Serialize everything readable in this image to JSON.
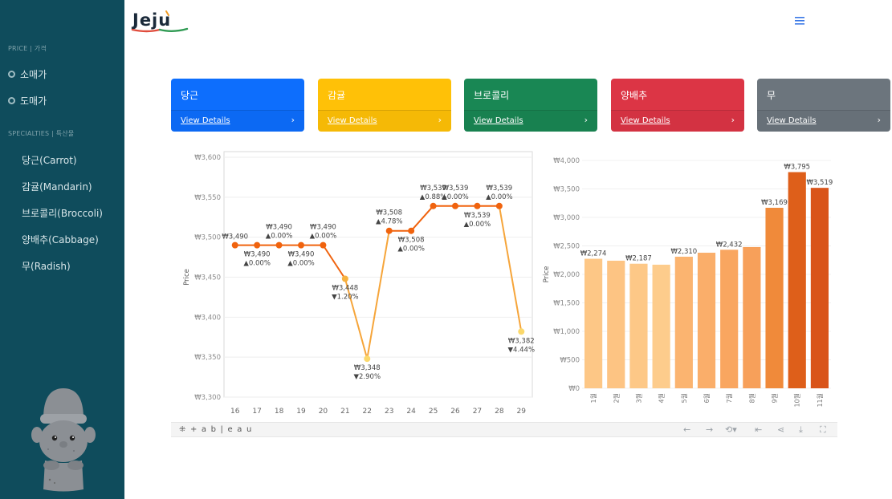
{
  "app": {
    "logo_text": "Jeju"
  },
  "sidebar": {
    "price_header": "PRICE | 가격",
    "price_items": [
      {
        "label": "소매가",
        "icon": "circle-icon"
      },
      {
        "label": "도매가",
        "icon": "circle-icon"
      }
    ],
    "specialties_header": "SPECIALTIES | 특산물",
    "specialties": [
      {
        "label": "당근(Carrot)"
      },
      {
        "label": "감귤(Mandarin)"
      },
      {
        "label": "브로콜리(Broccoli)"
      },
      {
        "label": "양배추(Cabbage)"
      },
      {
        "label": "무(Radish)"
      }
    ]
  },
  "header": {
    "menu_icon": "hamburger-icon"
  },
  "cards": [
    {
      "title": "당근",
      "link": "View Details",
      "color": "#0d6efd"
    },
    {
      "title": "감귤",
      "link": "View Details",
      "color": "#ffc107"
    },
    {
      "title": "브로콜리",
      "link": "View Details",
      "color": "#198754"
    },
    {
      "title": "양배추",
      "link": "View Details",
      "color": "#dc3545"
    },
    {
      "title": "무",
      "link": "View Details",
      "color": "#6c757d"
    }
  ],
  "tableau": {
    "brand": "+ a b | e a u"
  },
  "chart_data": [
    {
      "type": "line",
      "ylabel": "Price",
      "ylim": [
        3300,
        3600
      ],
      "yticks": [
        "₩3,600",
        "₩3,550",
        "₩3,500",
        "₩3,450",
        "₩3,400",
        "₩3,350",
        "₩3,300"
      ],
      "x": [
        "16",
        "17",
        "18",
        "19",
        "20",
        "21",
        "22",
        "23",
        "24",
        "25",
        "26",
        "27",
        "28",
        "29"
      ],
      "values": [
        3490,
        3490,
        3490,
        3490,
        3490,
        3448,
        3348,
        3508,
        3508,
        3539,
        3539,
        3539,
        3539,
        3382
      ],
      "labels": [
        {
          "price": "₩3,490",
          "change": ""
        },
        {
          "price": "₩3,490",
          "change": "▲0.00%"
        },
        {
          "price": "₩3,490",
          "change": "▲0.00%"
        },
        {
          "price": "₩3,490",
          "change": "▲0.00%"
        },
        {
          "price": "₩3,490",
          "change": "▲0.00%"
        },
        {
          "price": "₩3,448",
          "change": "▼1.20%"
        },
        {
          "price": "₩3,348",
          "change": "▼2.90%"
        },
        {
          "price": "₩3,508",
          "change": "▲4.78%"
        },
        {
          "price": "₩3,508",
          "change": "▲0.00%"
        },
        {
          "price": "₩3,539",
          "change": "▲0.88%"
        },
        {
          "price": "₩3,539",
          "change": "▲0.00%"
        },
        {
          "price": "₩3,539",
          "change": "▲0.00%"
        },
        {
          "price": "₩3,539",
          "change": "▲0.00%"
        },
        {
          "price": "₩3,382",
          "change": "▼4.44%"
        }
      ],
      "line_color": "#f0630e",
      "low_color": "#fbd86b"
    },
    {
      "type": "bar",
      "ylabel": "Price",
      "ylim": [
        0,
        4000
      ],
      "yticks": [
        "₩4,000",
        "₩3,500",
        "₩3,000",
        "₩2,500",
        "₩2,000",
        "₩1,500",
        "₩1,000",
        "₩500",
        "₩0"
      ],
      "categories": [
        "1월",
        "2월",
        "3월",
        "4월",
        "5월",
        "6월",
        "7월",
        "8월",
        "9월",
        "10월",
        "11월"
      ],
      "values": [
        2274,
        2240,
        2187,
        2170,
        2310,
        2380,
        2432,
        2480,
        3169,
        3795,
        3519
      ],
      "data_labels": [
        "₩2,274",
        "",
        "₩2,187",
        "",
        "₩2,310",
        "",
        "₩2,432",
        "",
        "₩3,169",
        "₩3,795",
        "₩3,519"
      ],
      "colors": [
        "#fdc786",
        "#fdc483",
        "#fdc887",
        "#fdcc8c",
        "#fbb470",
        "#faae6a",
        "#f9a660",
        "#f7a05a",
        "#f08a3a",
        "#de5f1a",
        "#d9541a"
      ]
    }
  ]
}
